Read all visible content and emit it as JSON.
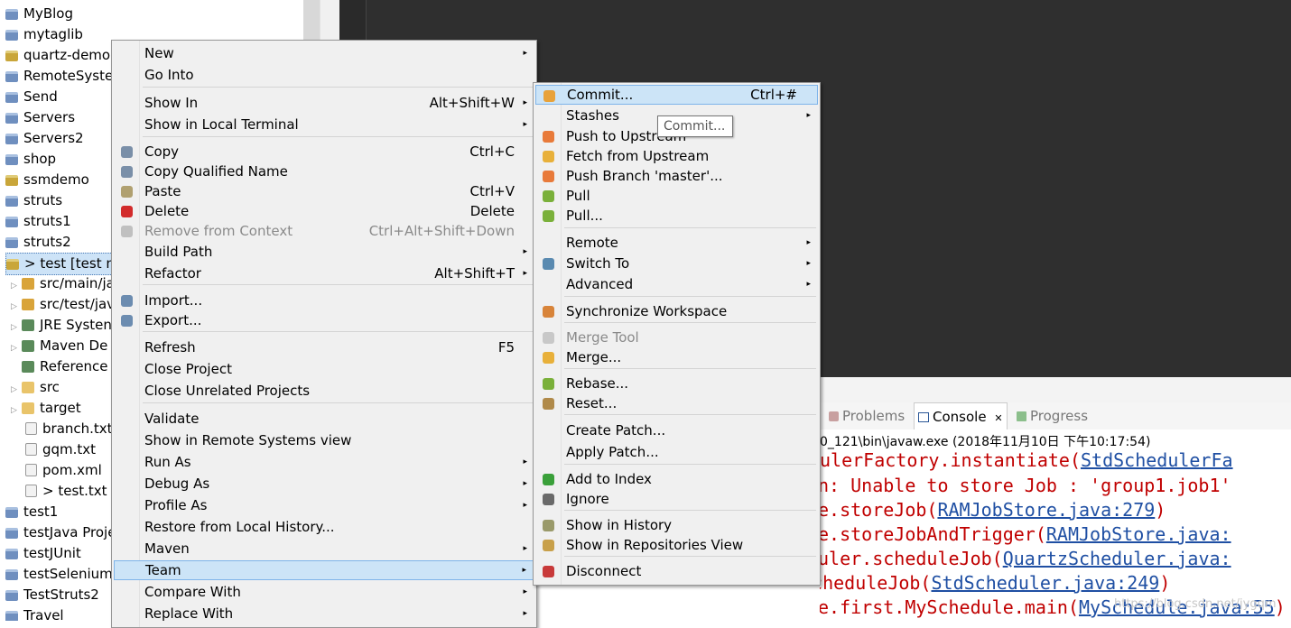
{
  "explorer": {
    "items": [
      {
        "label": "MyBlog"
      },
      {
        "label": "mytaglib"
      },
      {
        "label": "quartz-demo"
      },
      {
        "label": "RemoteSyste"
      },
      {
        "label": "Send"
      },
      {
        "label": "Servers"
      },
      {
        "label": "Servers2"
      },
      {
        "label": "shop"
      },
      {
        "label": "ssmdemo"
      },
      {
        "label": "struts"
      },
      {
        "label": "struts1"
      },
      {
        "label": "struts2"
      },
      {
        "label": "> test [test m"
      },
      {
        "label": "src/main/ja"
      },
      {
        "label": "src/test/jav"
      },
      {
        "label": "JRE Systen"
      },
      {
        "label": "Maven De"
      },
      {
        "label": "Reference"
      },
      {
        "label": "src"
      },
      {
        "label": "target"
      },
      {
        "label": "branch.txt"
      },
      {
        "label": "gqm.txt"
      },
      {
        "label": "pom.xml"
      },
      {
        "label": "> test.txt"
      },
      {
        "label": "test1"
      },
      {
        "label": "testJava Proje"
      },
      {
        "label": "testJUnit"
      },
      {
        "label": "testSelenium"
      },
      {
        "label": "TestStruts2"
      },
      {
        "label": "Travel"
      }
    ]
  },
  "context_menu": {
    "items": [
      {
        "label": "New",
        "accel": "",
        "sub": "▸"
      },
      {
        "label": "Go Into",
        "accel": "",
        "sub": ""
      },
      {
        "label": "Show In",
        "accel": "Alt+Shift+W",
        "sub": "▸"
      },
      {
        "label": "Show in Local Terminal",
        "accel": "",
        "sub": "▸"
      },
      {
        "label": "Copy",
        "accel": "Ctrl+C",
        "sub": ""
      },
      {
        "label": "Copy Qualified Name",
        "accel": "",
        "sub": ""
      },
      {
        "label": "Paste",
        "accel": "Ctrl+V",
        "sub": ""
      },
      {
        "label": "Delete",
        "accel": "Delete",
        "sub": ""
      },
      {
        "label": "Remove from Context",
        "accel": "Ctrl+Alt+Shift+Down",
        "sub": ""
      },
      {
        "label": "Build Path",
        "accel": "",
        "sub": "▸"
      },
      {
        "label": "Refactor",
        "accel": "Alt+Shift+T",
        "sub": "▸"
      },
      {
        "label": "Import...",
        "accel": "",
        "sub": ""
      },
      {
        "label": "Export...",
        "accel": "",
        "sub": ""
      },
      {
        "label": "Refresh",
        "accel": "F5",
        "sub": ""
      },
      {
        "label": "Close Project",
        "accel": "",
        "sub": ""
      },
      {
        "label": "Close Unrelated Projects",
        "accel": "",
        "sub": ""
      },
      {
        "label": "Validate",
        "accel": "",
        "sub": ""
      },
      {
        "label": "Show in Remote Systems view",
        "accel": "",
        "sub": ""
      },
      {
        "label": "Run As",
        "accel": "",
        "sub": "▸"
      },
      {
        "label": "Debug As",
        "accel": "",
        "sub": "▸"
      },
      {
        "label": "Profile As",
        "accel": "",
        "sub": "▸"
      },
      {
        "label": "Restore from Local History...",
        "accel": "",
        "sub": ""
      },
      {
        "label": "Maven",
        "accel": "",
        "sub": "▸"
      },
      {
        "label": "Team",
        "accel": "",
        "sub": "▸"
      },
      {
        "label": "Compare With",
        "accel": "",
        "sub": "▸"
      },
      {
        "label": "Replace With",
        "accel": "",
        "sub": "▸"
      }
    ]
  },
  "team_menu": {
    "items": [
      {
        "label": "Commit...",
        "accel": "Ctrl+#",
        "sub": ""
      },
      {
        "label": "Stashes",
        "accel": "",
        "sub": "▸"
      },
      {
        "label": "Push to Upstream",
        "accel": "",
        "sub": ""
      },
      {
        "label": "Fetch from Upstream",
        "accel": "",
        "sub": ""
      },
      {
        "label": "Push Branch 'master'...",
        "accel": "",
        "sub": ""
      },
      {
        "label": "Pull",
        "accel": "",
        "sub": ""
      },
      {
        "label": "Pull...",
        "accel": "",
        "sub": ""
      },
      {
        "label": "Remote",
        "accel": "",
        "sub": "▸"
      },
      {
        "label": "Switch To",
        "accel": "",
        "sub": "▸"
      },
      {
        "label": "Advanced",
        "accel": "",
        "sub": "▸"
      },
      {
        "label": "Synchronize Workspace",
        "accel": "",
        "sub": ""
      },
      {
        "label": "Merge Tool",
        "accel": "",
        "sub": ""
      },
      {
        "label": "Merge...",
        "accel": "",
        "sub": ""
      },
      {
        "label": "Rebase...",
        "accel": "",
        "sub": ""
      },
      {
        "label": "Reset...",
        "accel": "",
        "sub": ""
      },
      {
        "label": "Create Patch...",
        "accel": "",
        "sub": ""
      },
      {
        "label": "Apply Patch...",
        "accel": "",
        "sub": ""
      },
      {
        "label": "Add to Index",
        "accel": "",
        "sub": ""
      },
      {
        "label": "Ignore",
        "accel": "",
        "sub": ""
      },
      {
        "label": "Show in History",
        "accel": "",
        "sub": ""
      },
      {
        "label": "Show in Repositories View",
        "accel": "",
        "sub": ""
      },
      {
        "label": "Disconnect",
        "accel": "",
        "sub": ""
      }
    ]
  },
  "tooltip": {
    "text": "Commit..."
  },
  "console": {
    "tabs": {
      "problems": "Problems",
      "console": "Console",
      "console_close": "✕",
      "progress": "Progress"
    },
    "header": "0_121\\bin\\javaw.exe (2018年11月10日 下午10:17:54)",
    "lines": [
      {
        "text": "ulerFactory.instantiate(",
        "link": "StdSchedulerFa"
      },
      {
        "text": "n: Unable to store Job : 'group1.job1'",
        "link": ""
      },
      {
        "text": "e.storeJob(",
        "link": "RAMJobStore.java:279",
        "tail": ")"
      },
      {
        "text": "e.storeJobAndTrigger(",
        "link": "RAMJobStore.java:"
      },
      {
        "text": "uler.scheduleJob(",
        "link": "QuartzScheduler.java:"
      },
      {
        "text": "uartz.impl.StdScheduler.scheduleJob(",
        "link": "StdScheduler.java:249",
        "tail": ")"
      },
      {
        "text": "e.first.MySchedule.main(",
        "link": "MySchedule.java:55",
        "tail": ")"
      }
    ],
    "watermark": "https://blog.csdn.net/jygqm"
  }
}
